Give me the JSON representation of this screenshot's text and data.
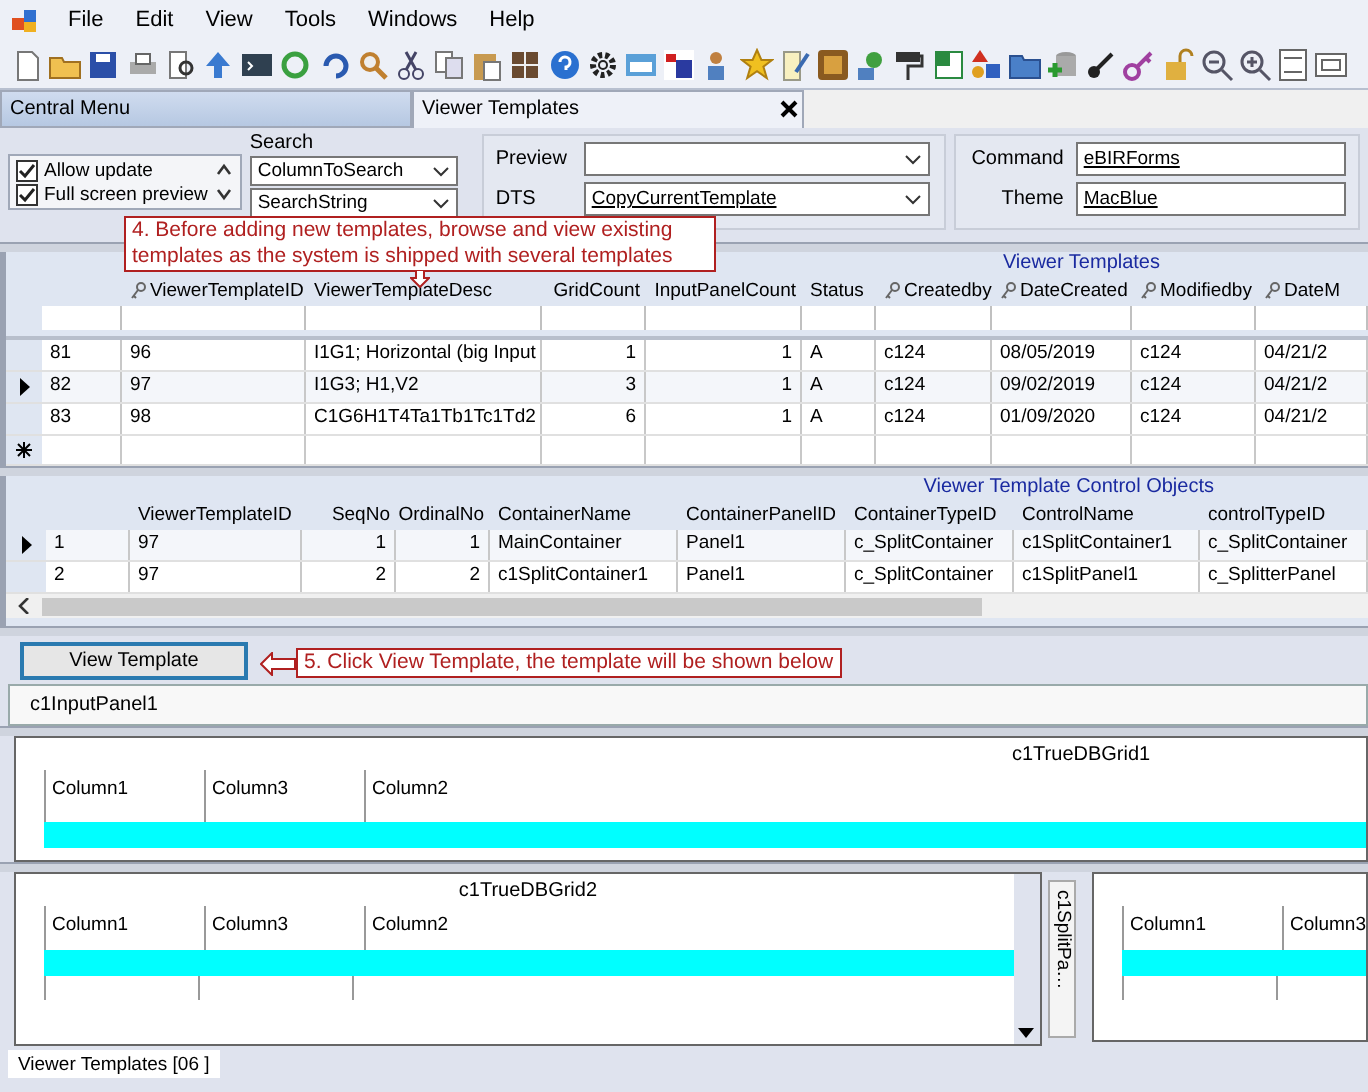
{
  "menu": [
    "File",
    "Edit",
    "View",
    "Tools",
    "Windows",
    "Help"
  ],
  "tabs": [
    {
      "label": "Central Menu",
      "selected": false
    },
    {
      "label": "Viewer Templates",
      "selected": true
    }
  ],
  "options": [
    {
      "label": "Allow update",
      "checked": true
    },
    {
      "label": "Full screen preview",
      "checked": true
    }
  ],
  "search": {
    "label": "Search",
    "column_field": "ColumnToSearch",
    "string_field": "SearchString"
  },
  "preview": {
    "label": "Preview"
  },
  "dts": {
    "label": "DTS",
    "value": "CopyCurrentTemplate"
  },
  "command": {
    "label": "Command",
    "value": "eBIRForms"
  },
  "theme": {
    "label": "Theme",
    "value": "MacBlue"
  },
  "callouts": [
    "4. Before adding new templates, browse and view existing templates as the system is shipped with several templates",
    "5. Click View Template, the template will be shown below"
  ],
  "templates_grid": {
    "title": "Viewer Templates",
    "columns": [
      {
        "label": "ViewerTemplateID",
        "keyed": true,
        "numeric": false
      },
      {
        "label": "ViewerTemplateDesc",
        "keyed": false,
        "numeric": false
      },
      {
        "label": "GridCount",
        "keyed": false,
        "numeric": true
      },
      {
        "label": "InputPanelCount",
        "keyed": false,
        "numeric": true
      },
      {
        "label": "Status",
        "keyed": false,
        "numeric": false
      },
      {
        "label": "Createdby",
        "keyed": true,
        "numeric": false
      },
      {
        "label": "DateCreated",
        "keyed": true,
        "numeric": false
      },
      {
        "label": "Modifiedby",
        "keyed": true,
        "numeric": false
      },
      {
        "label": "DateM",
        "keyed": true,
        "numeric": false
      }
    ],
    "rows": [
      {
        "row_no": "81",
        "selected": false,
        "cells": [
          "96",
          "I1G1; Horizontal (big Input",
          "1",
          "1",
          "A",
          "c124",
          "08/05/2019",
          "c124",
          "04/21/2"
        ]
      },
      {
        "row_no": "82",
        "selected": true,
        "cells": [
          "97",
          "I1G3; H1,V2",
          "3",
          "1",
          "A",
          "c124",
          "09/02/2019",
          "c124",
          "04/21/2"
        ]
      },
      {
        "row_no": "83",
        "selected": false,
        "cells": [
          "98",
          "C1G6H1T4Ta1Tb1Tc1Td2",
          "6",
          "1",
          "A",
          "c124",
          "01/09/2020",
          "c124",
          "04/21/2"
        ]
      }
    ]
  },
  "objects_grid": {
    "title": "Viewer Template Control Objects",
    "columns": [
      {
        "label": "ViewerTemplateID",
        "numeric": false
      },
      {
        "label": "SeqNo",
        "numeric": true
      },
      {
        "label": "OrdinalNo",
        "numeric": true
      },
      {
        "label": "ContainerName",
        "numeric": false
      },
      {
        "label": "ContainerPanelID",
        "numeric": false
      },
      {
        "label": "ContainerTypeID",
        "numeric": false
      },
      {
        "label": "ControlName",
        "numeric": false
      },
      {
        "label": "controlTypeID",
        "numeric": false
      }
    ],
    "rows": [
      {
        "row_no": "1",
        "selected": true,
        "cells": [
          "97",
          "1",
          "1",
          "MainContainer",
          "Panel1",
          "c_SplitContainer",
          "c1SplitContainer1",
          "c_SplitContainer"
        ]
      },
      {
        "row_no": "2",
        "selected": false,
        "cells": [
          "97",
          "2",
          "2",
          "c1SplitContainer1",
          "Panel1",
          "c_SplitContainer",
          "c1SplitPanel1",
          "c_SplitterPanel"
        ]
      }
    ]
  },
  "view_button": "View Template",
  "input_panel": "c1InputPanel1",
  "grid_1": {
    "title": "c1TrueDBGrid1",
    "columns": [
      "Column1",
      "Column3",
      "Column2"
    ]
  },
  "grid_2": {
    "title": "c1TrueDBGrid2",
    "columns": [
      "Column1",
      "Column3",
      "Column2"
    ]
  },
  "split_panel_tab": "c1SplitPa…",
  "grid_3": {
    "columns": [
      "Column1",
      "Column3"
    ]
  },
  "status_tab": "Viewer Templates [06  ]"
}
